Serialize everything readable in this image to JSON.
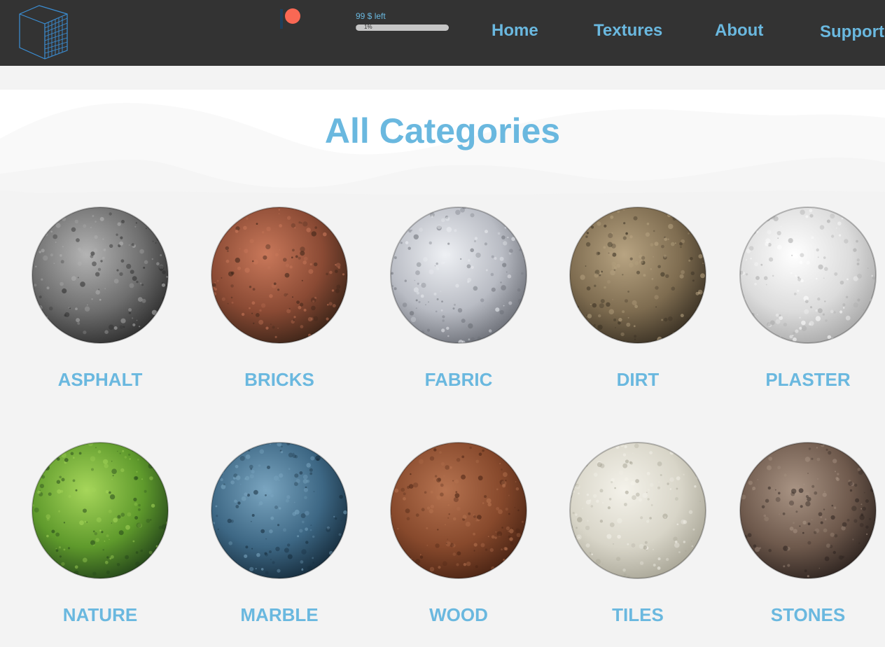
{
  "header": {
    "goal_text": "99 $ left",
    "goal_percent_text": "1%",
    "goal_progress": 0.01,
    "nav": [
      {
        "label": "Home"
      },
      {
        "label": "Textures"
      },
      {
        "label": "About"
      },
      {
        "label": "Support"
      }
    ],
    "colors": {
      "accent": "#6ab8df",
      "bar": "#333333",
      "patreon": "#f96854"
    }
  },
  "page": {
    "title": "All Categories"
  },
  "categories": [
    {
      "label": "ASPHALT",
      "colors": [
        "#b4b4b4",
        "#6e6e6e",
        "#2e2e2e"
      ]
    },
    {
      "label": "BRICKS",
      "colors": [
        "#c9785a",
        "#8a4a34",
        "#3b2418"
      ]
    },
    {
      "label": "FABRIC",
      "colors": [
        "#eef0f4",
        "#b9bcc4",
        "#6b6e76"
      ]
    },
    {
      "label": "DIRT",
      "colors": [
        "#b8a482",
        "#7e6c50",
        "#3a3124"
      ]
    },
    {
      "label": "PLASTER",
      "colors": [
        "#ffffff",
        "#dcdcdc",
        "#a8a8a8"
      ]
    },
    {
      "label": "NATURE",
      "colors": [
        "#a6d65a",
        "#5f9a2c",
        "#24451a"
      ]
    },
    {
      "label": "MARBLE",
      "colors": [
        "#7aa5c0",
        "#3d6784",
        "#162c3c"
      ]
    },
    {
      "label": "WOOD",
      "colors": [
        "#b67350",
        "#87492c",
        "#4a2414"
      ]
    },
    {
      "label": "TILES",
      "colors": [
        "#f4f2ea",
        "#d8d5c8",
        "#a8a596"
      ]
    },
    {
      "label": "STONES",
      "colors": [
        "#a99484",
        "#6e594c",
        "#2e2420"
      ]
    }
  ]
}
